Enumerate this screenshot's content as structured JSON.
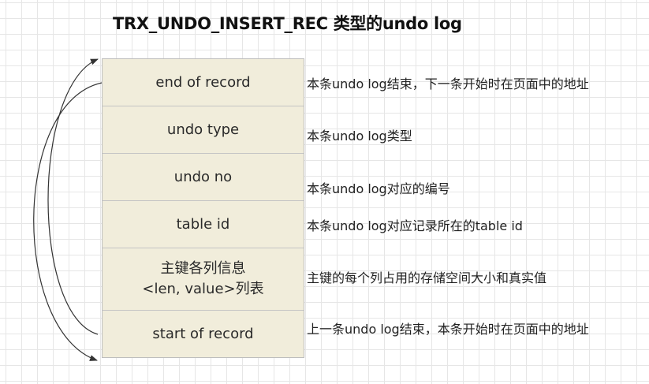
{
  "title": "TRX_UNDO_INSERT_REC 类型的undo log",
  "fields": [
    {
      "label": "end of record",
      "description": "本条undo log结束，下一条开始时在页面中的地址"
    },
    {
      "label": "undo type",
      "description": "本条undo log类型"
    },
    {
      "label": "undo no",
      "description": "本条undo log对应的编号"
    },
    {
      "label": "table id",
      "description": "本条undo log对应记录所在的table id"
    },
    {
      "label_line1": "主键各列信息",
      "label_line2": "<len, value>列表",
      "description": "主键的每个列占用的存储空间大小和真实值"
    },
    {
      "label": "start of record",
      "description": "上一条undo log结束，本条开始时在页面中的地址"
    }
  ],
  "colors": {
    "field_background": "#f1eddb",
    "border": "#bdbdbd",
    "arrow": "#333333"
  }
}
